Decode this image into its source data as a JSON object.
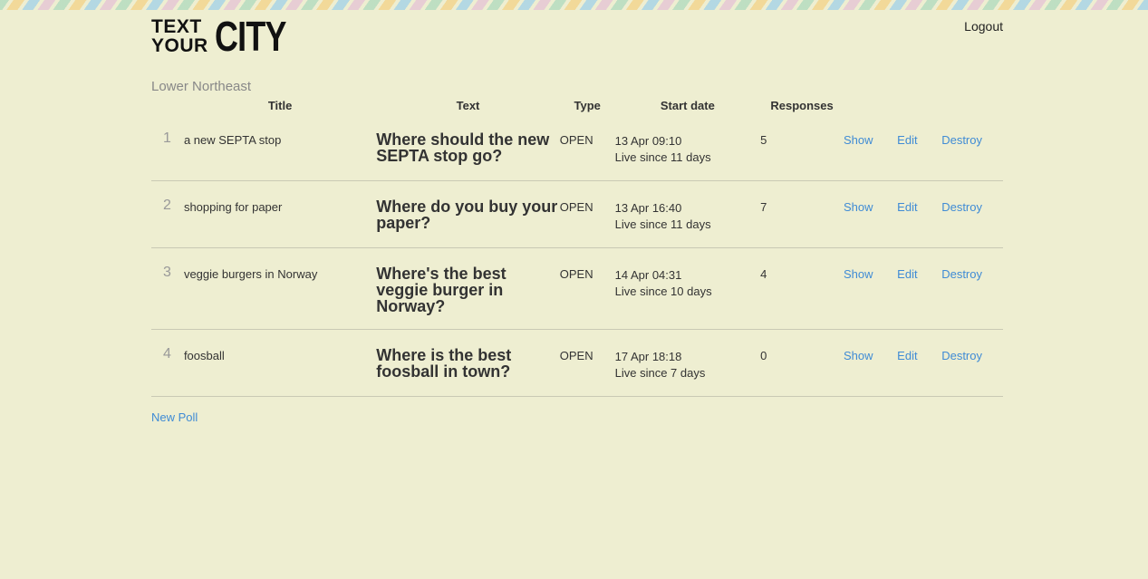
{
  "header": {
    "logo_line1": "TEXT",
    "logo_line2": "YOUR",
    "logo_city": "CITY",
    "logout_label": "Logout"
  },
  "section_title": "Lower Northeast",
  "table": {
    "columns": [
      "Title",
      "Text",
      "Type",
      "Start date",
      "Responses"
    ],
    "rows": [
      {
        "index": "1",
        "title": "a new SEPTA stop",
        "text": "Where should the new SEPTA stop go?",
        "type": "OPEN",
        "start_date": "13 Apr 09:10",
        "live_since": "Live since 11 days",
        "responses": "5"
      },
      {
        "index": "2",
        "title": "shopping for paper",
        "text": "Where do you buy your paper?",
        "type": "OPEN",
        "start_date": "13 Apr 16:40",
        "live_since": "Live since 11 days",
        "responses": "7"
      },
      {
        "index": "3",
        "title": "veggie burgers in Norway",
        "text": "Where's the best veggie burger in Norway?",
        "type": "OPEN",
        "start_date": "14 Apr 04:31",
        "live_since": "Live since 10 days",
        "responses": "4"
      },
      {
        "index": "4",
        "title": "foosball",
        "text": "Where is the best foosball in town?",
        "type": "OPEN",
        "start_date": "17 Apr 18:18",
        "live_since": "Live since 7 days",
        "responses": "0"
      }
    ],
    "actions": {
      "show": "Show",
      "edit": "Edit",
      "destroy": "Destroy"
    }
  },
  "new_poll_label": "New Poll",
  "colors": {
    "background": "#eeeed1",
    "link": "#3f8bd5",
    "muted": "#888888"
  }
}
